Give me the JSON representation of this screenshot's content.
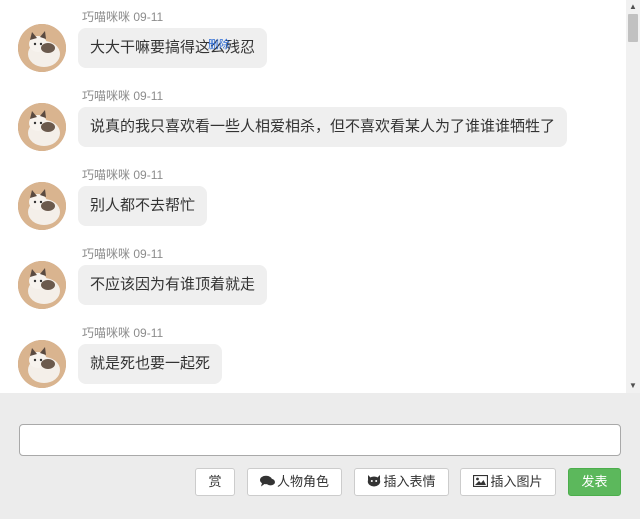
{
  "messages": [
    {
      "author": "巧喵咪咪",
      "date": "09-11",
      "text": "大大干嘛要搞得这么残忍"
    },
    {
      "author": "巧喵咪咪",
      "date": "09-11",
      "text": "说真的我只喜欢看一些人相爱相杀，但不喜欢看某人为了谁谁谁牺牲了"
    },
    {
      "author": "巧喵咪咪",
      "date": "09-11",
      "text": "别人都不去帮忙"
    },
    {
      "author": "巧喵咪咪",
      "date": "09-11",
      "text": "不应该因为有谁顶着就走"
    },
    {
      "author": "巧喵咪咪",
      "date": "09-11",
      "text": "就是死也要一起死"
    }
  ],
  "delete_label": "删除",
  "composer": {
    "input_value": "",
    "reward_label": "赏",
    "role_label": "人物角色",
    "emoji_label": "插入表情",
    "image_label": "插入图片",
    "send_label": "发表"
  },
  "colors": {
    "bubble": "#efefef",
    "send_button": "#5cb85c",
    "link": "#2a6ad6"
  }
}
